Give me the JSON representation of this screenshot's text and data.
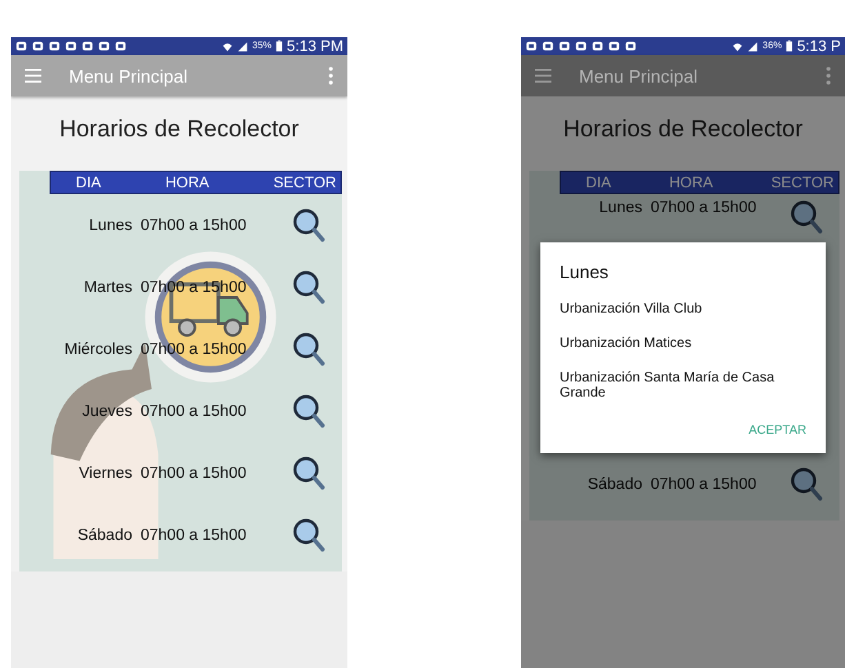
{
  "screens": [
    {
      "dimmed": false,
      "status_bar": {
        "battery": "35%",
        "time": "5:13 PM"
      },
      "app_bar": {
        "title": "Menu Principal"
      },
      "heading": "Horarios de Recolector",
      "table": {
        "columns": [
          "DIA",
          "HORA",
          "SECTOR"
        ],
        "rows": [
          {
            "day": "Lunes",
            "hours": "07h00 a 15h00"
          },
          {
            "day": "Martes",
            "hours": "07h00 a 15h00"
          },
          {
            "day": "Miércoles",
            "hours": "07h00 a 15h00"
          },
          {
            "day": "Jueves",
            "hours": "07h00 a 15h00"
          },
          {
            "day": "Viernes",
            "hours": "07h00 a 15h00"
          },
          {
            "day": "Sábado",
            "hours": "07h00 a 15h00"
          }
        ]
      }
    },
    {
      "dimmed": true,
      "status_bar": {
        "battery": "36%",
        "time": "5:13 P"
      },
      "app_bar": {
        "title": "Menu Principal"
      },
      "heading": "Horarios de Recolector",
      "table": {
        "columns": [
          "DIA",
          "HORA",
          "SECTOR"
        ],
        "rows": [
          {
            "day": "Lunes",
            "hours": "07h00 a 15h00"
          },
          {
            "day": "Sábado",
            "hours": "07h00 a 15h00"
          }
        ]
      },
      "dialog": {
        "title": "Lunes",
        "items": [
          "Urbanización Villa Club",
          "Urbanización Matices",
          "Urbanización Santa María de Casa Grande"
        ],
        "button": "ACEPTAR"
      }
    }
  ]
}
